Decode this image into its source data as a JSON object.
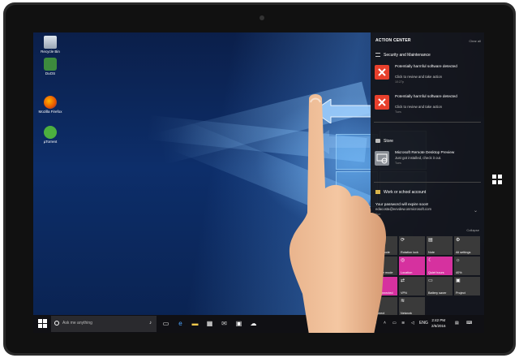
{
  "desktop": {
    "icons": [
      {
        "label": "Recycle Bin",
        "icon": "recycle-bin-icon"
      },
      {
        "label": "DuOS",
        "icon": "duos-icon"
      },
      {
        "label": "Mozilla Firefox",
        "icon": "firefox-icon"
      },
      {
        "label": "µTorrent",
        "icon": "utorrent-icon"
      }
    ]
  },
  "action_center": {
    "title": "ACTION CENTER",
    "clear_all": "Clear all",
    "groups": {
      "security": {
        "label": "Security and Maintenance",
        "notifications": [
          {
            "title": "Potentially harmful software detected",
            "body": "Click to review and take action",
            "time": "10:27p"
          },
          {
            "title": "Potentially harmful software detected",
            "body": "Click to review and take action",
            "time": "Tues"
          }
        ]
      },
      "store": {
        "label": "Store",
        "notifications": [
          {
            "title": "Microsoft Remote Desktop Preview",
            "body": "Just got installed, check it out.",
            "time": "Tues"
          }
        ]
      },
      "work": {
        "label": "Work or school account",
        "notifications": [
          {
            "title": "Your password will expire soon!",
            "body": "edacosta@eevdew.onmicrosoft.com",
            "time": "Sun"
          }
        ]
      }
    },
    "collapse": "Collapse",
    "quick_actions": [
      {
        "label": "Tablet mode",
        "icon": "tablet-icon",
        "on": false
      },
      {
        "label": "Rotation lock",
        "icon": "rotation-lock-icon",
        "on": false
      },
      {
        "label": "Note",
        "icon": "note-icon",
        "on": false
      },
      {
        "label": "All settings",
        "icon": "gear-icon",
        "on": false
      },
      {
        "label": "Airplane mode",
        "icon": "airplane-icon",
        "on": false
      },
      {
        "label": "Location",
        "icon": "location-icon",
        "on": true
      },
      {
        "label": "Quiet hours",
        "icon": "moon-icon",
        "on": true
      },
      {
        "label": "40%",
        "icon": "brightness-icon",
        "on": false
      },
      {
        "label": "Not connected",
        "icon": "bluetooth-icon",
        "on": true
      },
      {
        "label": "VPN",
        "icon": "vpn-icon",
        "on": false
      },
      {
        "label": "Battery saver",
        "icon": "battery-icon",
        "on": false
      },
      {
        "label": "Project",
        "icon": "project-icon",
        "on": false
      },
      {
        "label": "Connect",
        "icon": "connect-icon",
        "on": false
      },
      {
        "label": "Network",
        "icon": "network-icon",
        "on": false
      }
    ]
  },
  "taskbar": {
    "search_placeholder": "Ask me anything",
    "clock_time": "2:42 PM",
    "clock_date": "2/6/2016",
    "language": "ENG"
  },
  "colors": {
    "accent": "#d6319f",
    "error": "#e8402c"
  }
}
